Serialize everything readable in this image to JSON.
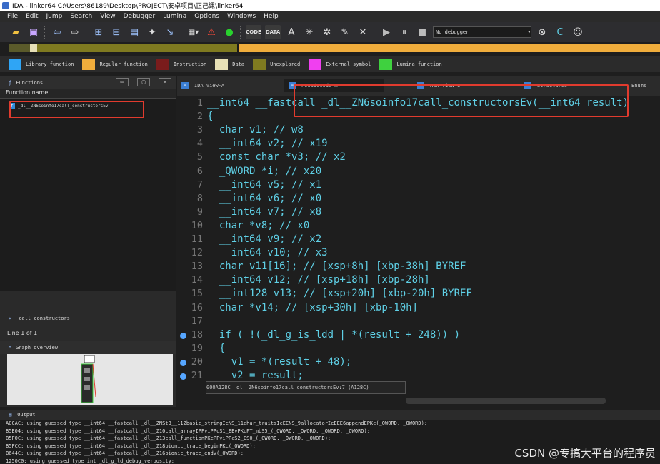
{
  "window": {
    "title": "IDA - linker64 C:\\Users\\86189\\Desktop\\PROJECT\\安卓项目\\正己课\\linker64"
  },
  "menu": [
    "File",
    "Edit",
    "Jump",
    "Search",
    "View",
    "Debugger",
    "Lumina",
    "Options",
    "Windows",
    "Help"
  ],
  "toolbar": {
    "debugger_select": "No debugger"
  },
  "legend": [
    {
      "label": "Library function",
      "color": "#2fa5f5"
    },
    {
      "label": "Regular function",
      "color": "#f0ad3c"
    },
    {
      "label": "Instruction",
      "color": "#7a1c1c"
    },
    {
      "label": "Data",
      "color": "#e7e0b6"
    },
    {
      "label": "Unexplored",
      "color": "#7f7a20"
    },
    {
      "label": "External symbol",
      "color": "#f03ff0"
    },
    {
      "label": "Lumina function",
      "color": "#3fd13f"
    }
  ],
  "functions_pane": {
    "title": "Functions",
    "column": "Function name",
    "items": [
      "_dl__ZN6soinfo17call_constructorsEv"
    ],
    "call_item": "call_constructors",
    "line_info": "Line 1 of 1",
    "graph_title": "Graph overview"
  },
  "tabs": [
    {
      "label": "IDA View-A"
    },
    {
      "label": "Pseudocode-A"
    },
    {
      "label": "Hex View-1"
    },
    {
      "label": "Structures"
    },
    {
      "label": "Enums"
    }
  ],
  "code": {
    "lines": [
      {
        "n": "1",
        "text": "__int64 __fastcall _dl__ZN6soinfo17call_constructorsEv(__int64 result)"
      },
      {
        "n": "2",
        "text": "{"
      },
      {
        "n": "3",
        "text": "  char v1; // w8"
      },
      {
        "n": "4",
        "text": "  __int64 v2; // x19"
      },
      {
        "n": "5",
        "text": "  const char *v3; // x2"
      },
      {
        "n": "6",
        "text": "  _QWORD *i; // x20"
      },
      {
        "n": "7",
        "text": "  __int64 v5; // x1"
      },
      {
        "n": "8",
        "text": "  __int64 v6; // x0"
      },
      {
        "n": "9",
        "text": "  __int64 v7; // x8"
      },
      {
        "n": "10",
        "text": "  char *v8; // x0"
      },
      {
        "n": "11",
        "text": "  __int64 v9; // x2"
      },
      {
        "n": "12",
        "text": "  __int64 v10; // x3"
      },
      {
        "n": "13",
        "text": "  char v11[16]; // [xsp+8h] [xbp-38h] BYREF"
      },
      {
        "n": "14",
        "text": "  __int64 v12; // [xsp+18h] [xbp-28h]"
      },
      {
        "n": "15",
        "text": "  __int128 v13; // [xsp+20h] [xbp-20h] BYREF"
      },
      {
        "n": "16",
        "text": "  char *v14; // [xsp+30h] [xbp-10h]"
      },
      {
        "n": "17",
        "text": ""
      },
      {
        "n": "18",
        "text": "  if ( !(_dl_g_is_ldd | *(result + 248)) )"
      },
      {
        "n": "19",
        "text": "  {"
      },
      {
        "n": "20",
        "text": "    v1 = *(result + 48);"
      },
      {
        "n": "21",
        "text": "    v2 = result;"
      }
    ],
    "breakpoints": [
      "18",
      "20",
      "21"
    ],
    "status": "000A128C _dl__ZN6soinfo17call_constructorsEv:7 (A128C)"
  },
  "output": {
    "title": "Output",
    "lines": [
      "A0CAC: using guessed type __int64 __fastcall _dl__ZNSt3__112basic_stringIcNS_11char_traitsIcEENS_9allocatorIcEEE6appendEPKc(_QWORD, _QWORD);",
      "B5E04: using guessed type __int64 __fastcall _dl__Z10call_arrayIPFviPPcS1_EEvPKcPT_mbS5_(_QWORD, _QWORD, _QWORD, _QWORD);",
      "B5F0C: using guessed type __int64 __fastcall _dl__Z13call_functionPKcPFviPPcS2_ES0_(_QWORD, _QWORD, _QWORD);",
      "B5FCC: using guessed type __int64 __fastcall _dl__Z18bionic_trace_beginPKc(_QWORD);",
      "B644C: using guessed type __int64 __fastcall _dl__Z16bionic_trace_endv(_QWORD);",
      "1250C0: using guessed type int _dl_g_ld_debug_verbosity;"
    ]
  },
  "watermark": "CSDN @专搞大平台的程序员"
}
